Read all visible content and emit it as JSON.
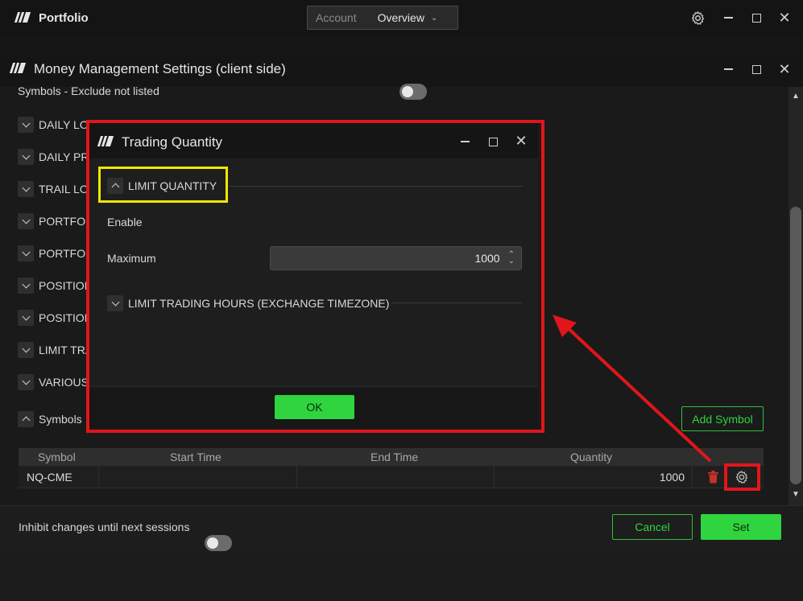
{
  "app": {
    "title": "Portfolio",
    "account_label": "Account",
    "overview_label": "Overview"
  },
  "mm_window": {
    "title": "Money Management Settings (client side)",
    "symbols_exclude_label": "Symbols - Exclude not listed",
    "sections": [
      {
        "label": "DAILY LO"
      },
      {
        "label": "DAILY PR"
      },
      {
        "label": "TRAIL LO"
      },
      {
        "label": "PORTFOL"
      },
      {
        "label": "PORTFOL"
      },
      {
        "label": "POSITION"
      },
      {
        "label": "POSITION"
      },
      {
        "label": "LIMIT TRA"
      },
      {
        "label": "VARIOUS"
      },
      {
        "label": "Symbols"
      }
    ],
    "add_symbol_label": "Add Symbol",
    "table": {
      "headers": [
        "Symbol",
        "Start Time",
        "End Time",
        "Quantity"
      ],
      "rows": [
        {
          "symbol": "NQ-CME",
          "start_time": "",
          "end_time": "",
          "quantity": "1000"
        }
      ]
    },
    "inhibit_label": "Inhibit changes until next sessions",
    "cancel_label": "Cancel",
    "set_label": "Set"
  },
  "dialog": {
    "title": "Trading Quantity",
    "limit_quantity_label": "LIMIT QUANTITY",
    "enable_label": "Enable",
    "enable_on": true,
    "maximum_label": "Maximum",
    "maximum_value": "1000",
    "limit_hours_label": "LIMIT TRADING HOURS (EXCHANGE TIMEZONE)",
    "ok_label": "OK"
  },
  "colors": {
    "accent_green": "#2fd43f",
    "highlight_red": "#e0161a",
    "highlight_yellow": "#f2e600"
  }
}
